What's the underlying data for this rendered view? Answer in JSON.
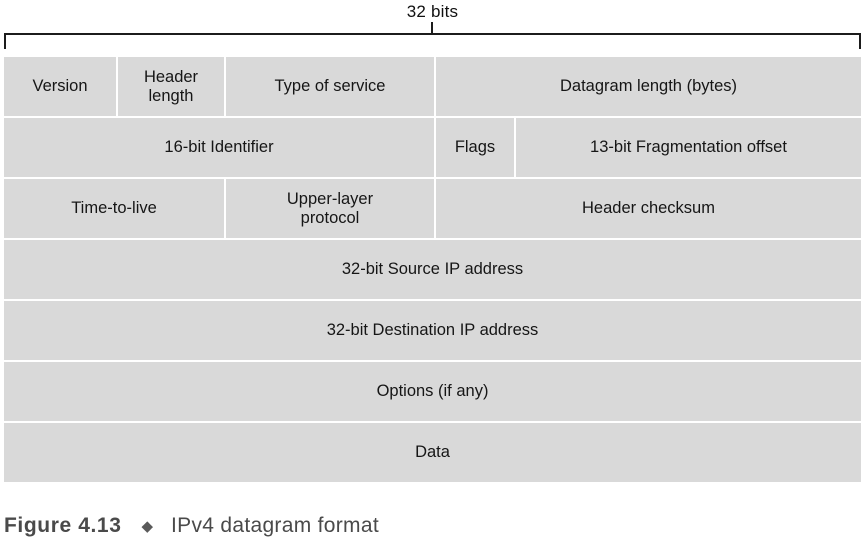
{
  "figure": {
    "width_label": "32 bits",
    "caption_number": "Figure 4.13",
    "caption_diamond": "◆",
    "caption_title": "IPv4 datagram format"
  },
  "colors": {
    "cell_fill": "#d9d9d9",
    "text": "#161616",
    "line": "#1c1c1c",
    "caption": "#4a4a4a",
    "page_background": "#ffffff"
  },
  "datagram": {
    "rows": [
      {
        "cells": [
          {
            "label": "Version"
          },
          {
            "label_line1": "Header",
            "label_line2": "length"
          },
          {
            "label": "Type of service"
          },
          {
            "label": "Datagram length (bytes)"
          }
        ]
      },
      {
        "cells": [
          {
            "label": "16-bit Identifier"
          },
          {
            "label": "Flags"
          },
          {
            "label": "13-bit Fragmentation offset"
          }
        ]
      },
      {
        "cells": [
          {
            "label": "Time-to-live"
          },
          {
            "label_line1": "Upper-layer",
            "label_line2": "protocol"
          },
          {
            "label": "Header checksum"
          }
        ]
      },
      {
        "cells": [
          {
            "label": "32-bit Source IP address"
          }
        ]
      },
      {
        "cells": [
          {
            "label": "32-bit Destination IP address"
          }
        ]
      },
      {
        "cells": [
          {
            "label": "Options (if any)"
          }
        ]
      },
      {
        "cells": [
          {
            "label": "Data"
          }
        ]
      }
    ]
  }
}
